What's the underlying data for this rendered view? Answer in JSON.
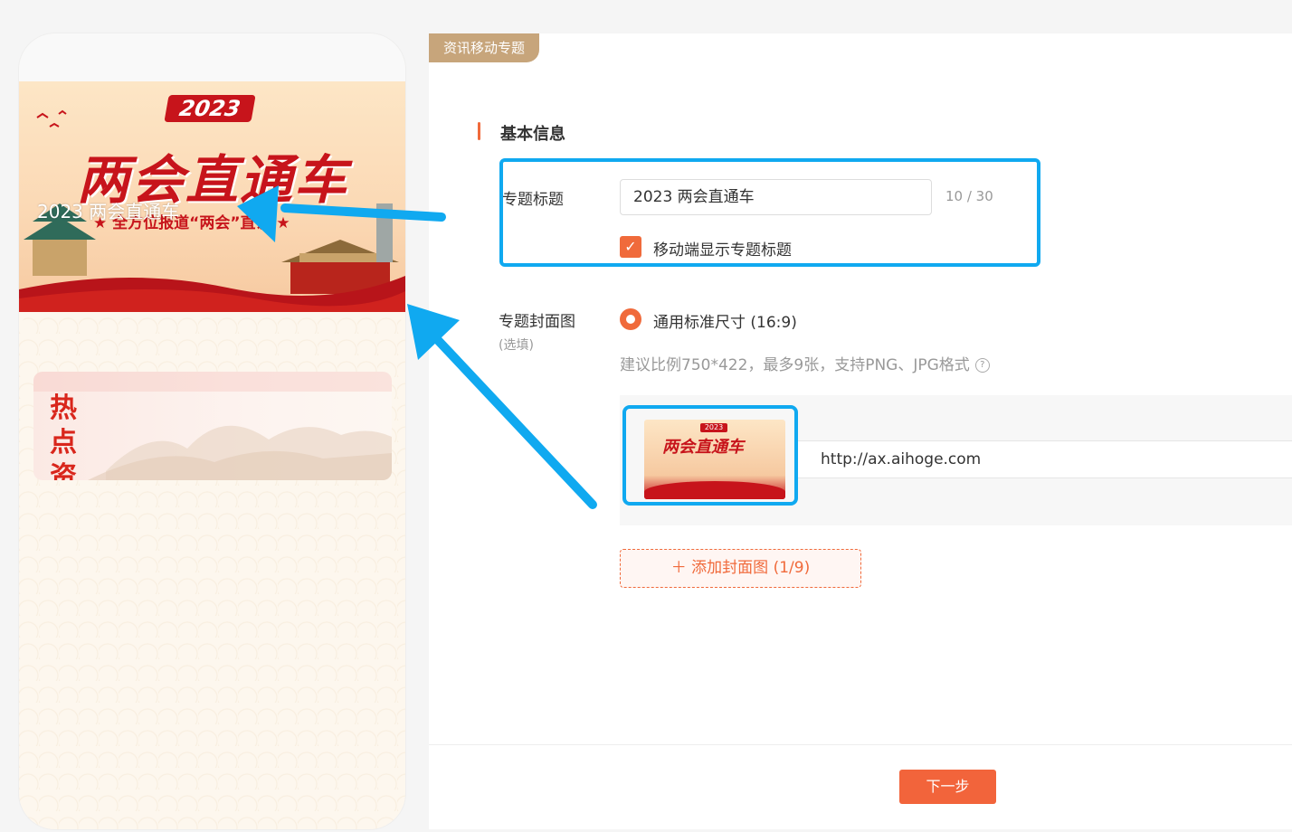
{
  "preview": {
    "banner_year": "2023",
    "banner_big_title": "两会直通车",
    "banner_slogan": "★ 全方位报道“两会”直说 ★",
    "overlay_title": "2023 两会直通车",
    "hot_news": "热点资讯"
  },
  "editor": {
    "tab": "资讯移动专题",
    "section_title": "基本信息",
    "title_label": "专题标题",
    "title_value": "2023 两会直通车",
    "title_counter": "10 / 30",
    "show_title_checkbox": {
      "checked": true,
      "label": "移动端显示专题标题"
    },
    "cover_label": "专题封面图",
    "cover_optional": "(选填)",
    "size_option": "通用标准尺寸 (16:9)",
    "hint": "建议比例750*422，最多9张，支持PNG、JPG格式",
    "help_icon": "?",
    "cover_image": {
      "year": "2023",
      "title": "两会直通车",
      "url": "http://ax.aihoge.com"
    },
    "add_cover_button": "＋ 添加封面图 (1/9)",
    "next_button": "下一步"
  },
  "colors": {
    "accent": "#f06a3b",
    "highlight": "#10a9f0",
    "tab_bg": "#c7a57b",
    "banner_red": "#c7141b"
  }
}
